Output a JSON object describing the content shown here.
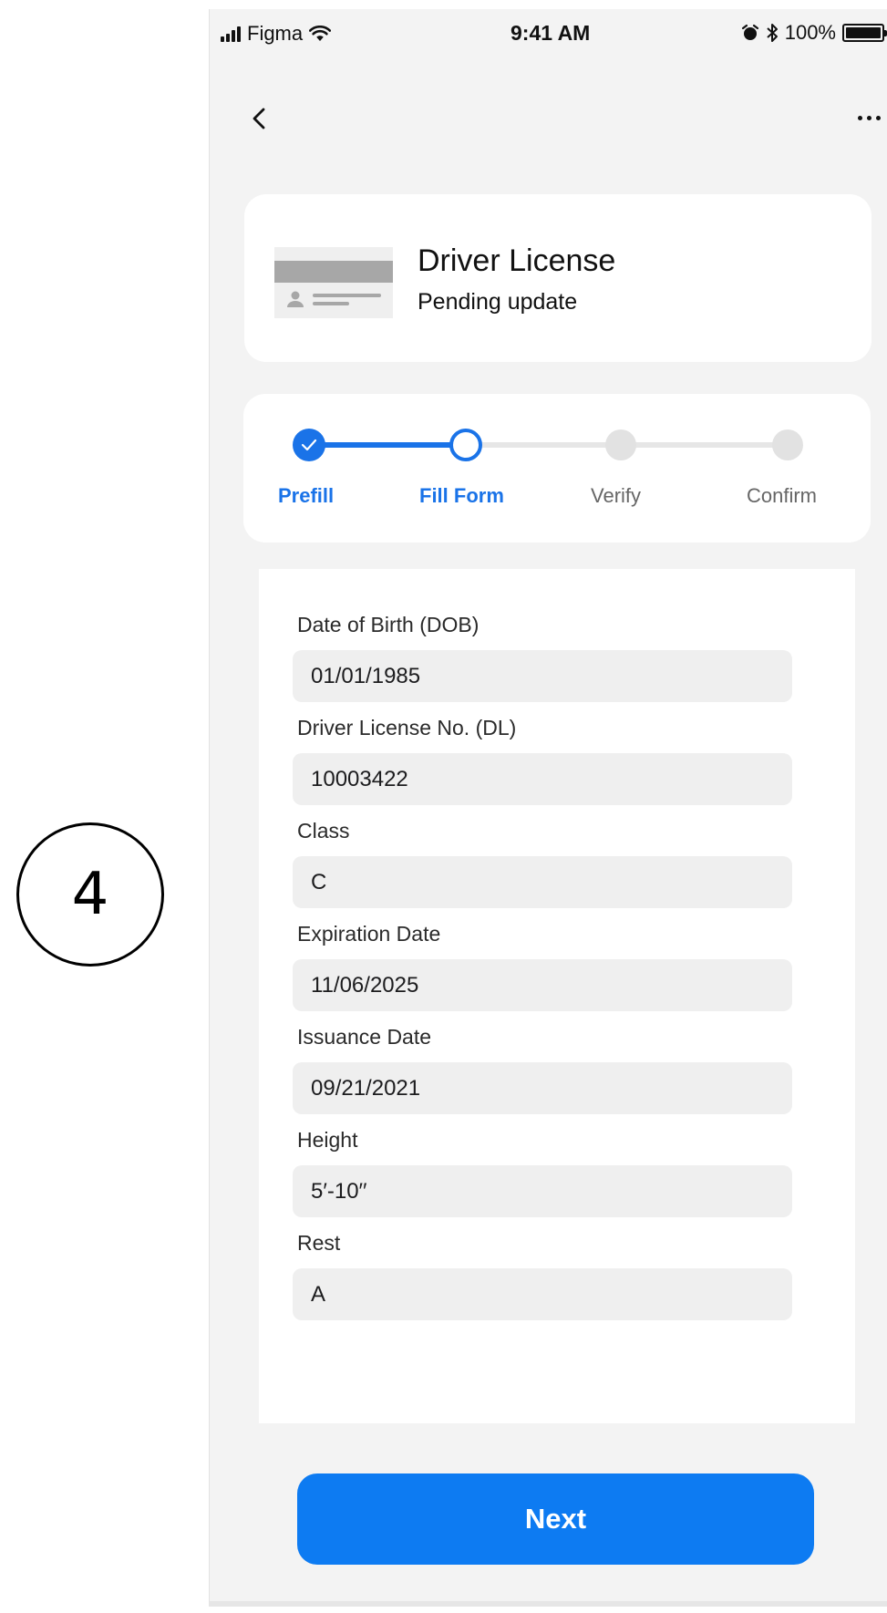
{
  "annotation": {
    "step_number": "4"
  },
  "status_bar": {
    "carrier": "Figma",
    "time": "9:41 AM",
    "battery": "100%"
  },
  "nav": {
    "back_icon": "chevron-left-icon",
    "more_icon": "ellipsis-icon"
  },
  "document": {
    "title": "Driver License",
    "status": "Pending update"
  },
  "stepper": {
    "current_index": 1,
    "accent_color": "#1a73e8",
    "steps": [
      {
        "label": "Prefill",
        "state": "done"
      },
      {
        "label": "Fill Form",
        "state": "current"
      },
      {
        "label": "Verify",
        "state": "pending"
      },
      {
        "label": "Confirm",
        "state": "pending"
      }
    ]
  },
  "form": {
    "fields": [
      {
        "label": "Date of Birth (DOB)",
        "value": "01/01/1985"
      },
      {
        "label": "Driver License No. (DL)",
        "value": "10003422"
      },
      {
        "label": "Class",
        "value": "C"
      },
      {
        "label": "Expiration Date",
        "value": "11/06/2025"
      },
      {
        "label": "Issuance Date",
        "value": "09/21/2021"
      },
      {
        "label": "Height",
        "value": "5′-10′′"
      },
      {
        "label": "Rest",
        "value": "A"
      }
    ]
  },
  "actions": {
    "next_label": "Next",
    "button_color": "#0d7bf2"
  }
}
